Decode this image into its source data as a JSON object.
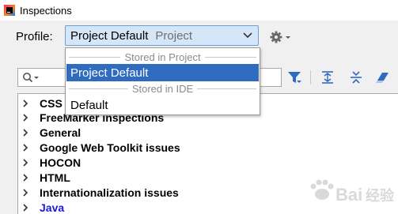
{
  "window": {
    "title": "Inspections",
    "icon": "intellij-idea-icon"
  },
  "profile": {
    "label": "Profile:",
    "selected_value": "Project Default",
    "selected_scope": "Project",
    "gear_icon": "gear-icon"
  },
  "dropdown": {
    "group_project": "Stored in Project",
    "group_ide": "Stored in IDE",
    "items": [
      {
        "label": "Project Default",
        "selected": true
      },
      {
        "label": "Default",
        "selected": false
      }
    ],
    "selected_color": "#2f6bbf"
  },
  "search": {
    "icon": "search-icon"
  },
  "toolbar": {
    "icons": [
      "filter-icon",
      "expand-all-icon",
      "collapse-all-icon",
      "reset-eraser-icon"
    ],
    "filter_color": "#2f6bbf"
  },
  "tree": {
    "items": [
      {
        "label": "CSS",
        "lang": false
      },
      {
        "label": "FreeMarker inspections",
        "lang": false
      },
      {
        "label": "General",
        "lang": false
      },
      {
        "label": "Google Web Toolkit issues",
        "lang": false
      },
      {
        "label": "HOCON",
        "lang": false
      },
      {
        "label": "HTML",
        "lang": false
      },
      {
        "label": "Internationalization issues",
        "lang": false
      },
      {
        "label": "Java",
        "lang": true
      }
    ],
    "lang_color": "#1a1ad6"
  },
  "watermark": {
    "text": "Bai经验"
  }
}
